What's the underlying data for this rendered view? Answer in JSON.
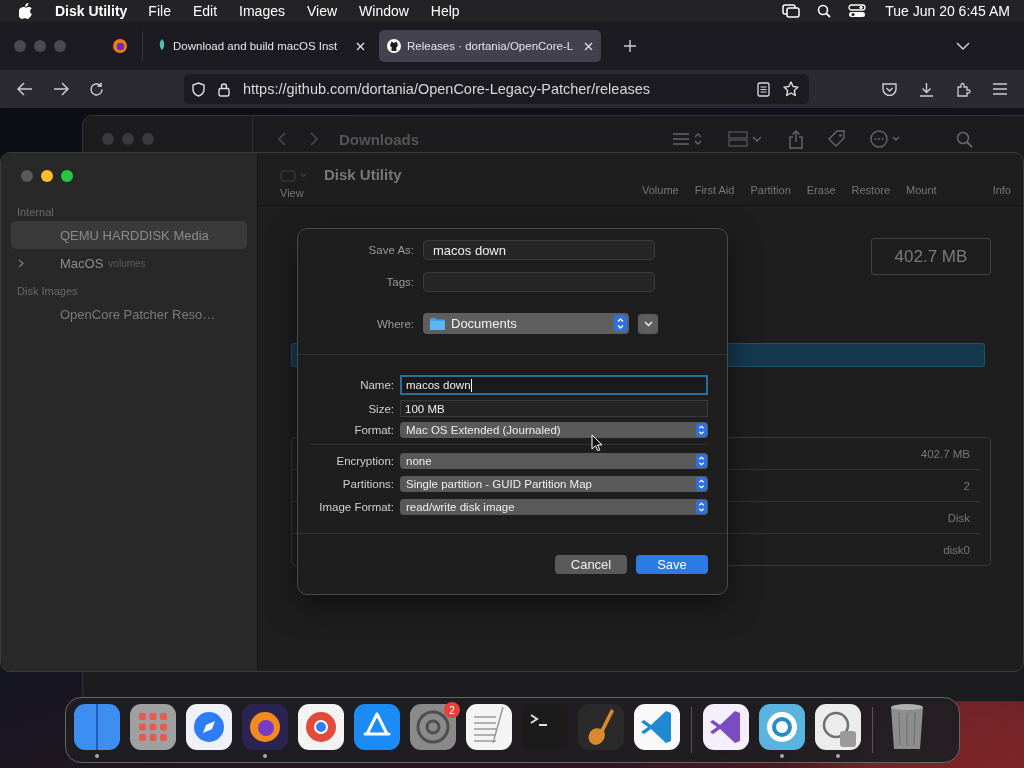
{
  "menubar": {
    "app_name": "Disk Utility",
    "menus": [
      "File",
      "Edit",
      "Images",
      "View",
      "Window",
      "Help"
    ],
    "clock": "Tue Jun 20  6:45 AM"
  },
  "browser": {
    "tabs": [
      {
        "kind": "doc",
        "title": "Download and build macOS Inst",
        "selected": false
      },
      {
        "kind": "github",
        "title": "Releases · dortania/OpenCore-L",
        "selected": true
      }
    ],
    "url": "https://github.com/dortania/OpenCore-Legacy-Patcher/releases"
  },
  "finder": {
    "title": "Downloads"
  },
  "disk_utility": {
    "title": "Disk Utility",
    "view_label": "View",
    "actions": [
      "Volume",
      "First Aid",
      "Partition",
      "Erase",
      "Restore",
      "Mount",
      "Info"
    ],
    "sidebar": [
      {
        "heading": "Internal",
        "items": [
          {
            "name": "QEMU HARDDISK Media",
            "expandable": false,
            "selected": true
          },
          {
            "name": "MacOS",
            "detail": "volumes",
            "expandable": true,
            "selected": false
          }
        ]
      },
      {
        "heading": "Disk Images",
        "items": [
          {
            "name": "OpenCore Patcher Reso…",
            "expandable": false,
            "selected": false
          }
        ]
      }
    ],
    "capacity": "402.7 MB",
    "info_values": [
      "402.7 MB",
      "2",
      "Disk",
      "disk0"
    ]
  },
  "dialog": {
    "save_as": {
      "label": "Save As:",
      "value": "macos down"
    },
    "tags": {
      "label": "Tags:"
    },
    "where": {
      "label": "Where:",
      "value": "Documents"
    },
    "groups": [
      {
        "fields": [
          {
            "kind": "text",
            "label": "Name:",
            "value": "macos down",
            "focused": true
          },
          {
            "kind": "text",
            "label": "Size:",
            "value": "100 MB",
            "focused": false
          },
          {
            "kind": "popup",
            "label": "Format:",
            "value": "Mac OS Extended (Journaled)"
          }
        ]
      },
      {
        "fields": [
          {
            "kind": "popup",
            "label": "Encryption:",
            "value": "none"
          },
          {
            "kind": "popup",
            "label": "Partitions:",
            "value": "Single partition - GUID Partition Map"
          },
          {
            "kind": "popup",
            "label": "Image Format:",
            "value": "read/write disk image"
          }
        ]
      }
    ],
    "buttons": [
      {
        "label": "Cancel",
        "default": false
      },
      {
        "label": "Save",
        "default": true
      }
    ]
  },
  "dock": [
    {
      "kind": "finder",
      "running": true
    },
    {
      "kind": "launchpad",
      "running": false
    },
    {
      "kind": "safari",
      "running": false
    },
    {
      "kind": "firefox",
      "running": true
    },
    {
      "kind": "chrome",
      "running": false
    },
    {
      "kind": "appstore",
      "running": false
    },
    {
      "kind": "settings",
      "running": false,
      "badge": "2"
    },
    {
      "kind": "textedit",
      "running": false
    },
    {
      "kind": "terminal",
      "running": false
    },
    {
      "kind": "garageband",
      "running": false
    },
    {
      "kind": "vscode",
      "running": false
    },
    {
      "kind": "separator"
    },
    {
      "kind": "visualstudio",
      "running": false
    },
    {
      "kind": "ring",
      "running": true
    },
    {
      "kind": "diskutility",
      "running": true
    },
    {
      "kind": "separator"
    },
    {
      "kind": "trash",
      "running": false
    }
  ]
}
